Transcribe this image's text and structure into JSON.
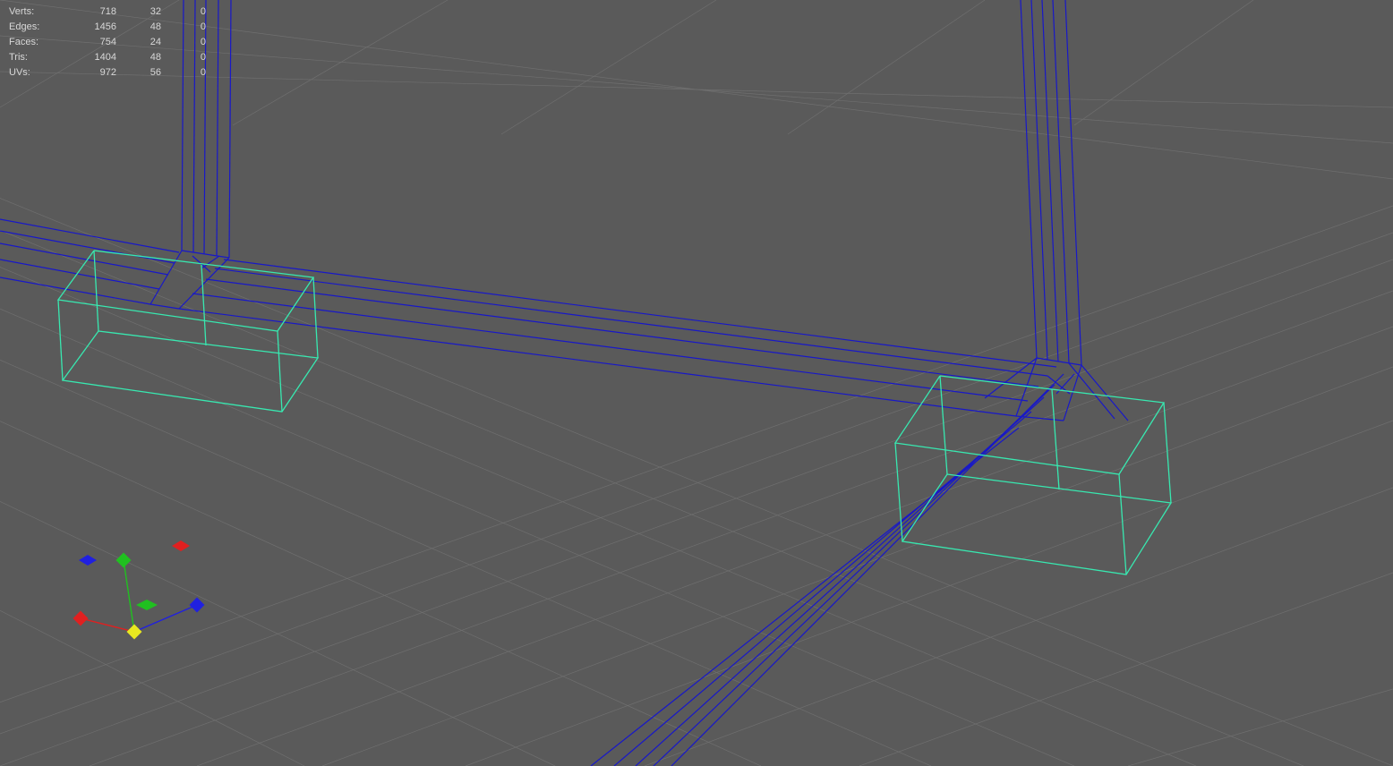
{
  "stats": {
    "rows": [
      {
        "label": "Verts:",
        "v1": "718",
        "v2": "32",
        "v3": "0"
      },
      {
        "label": "Edges:",
        "v1": "1456",
        "v2": "48",
        "v3": "0"
      },
      {
        "label": "Faces:",
        "v1": "754",
        "v2": "24",
        "v3": "0"
      },
      {
        "label": "Tris:",
        "v1": "1404",
        "v2": "48",
        "v3": "0"
      },
      {
        "label": "UVs:",
        "v1": "972",
        "v2": "56",
        "v3": "0"
      }
    ]
  },
  "colors": {
    "grid": "#6f6f6f",
    "wireframe": "#2020c0",
    "selected": "#40e8b8",
    "axis_x": "#e02020",
    "axis_y": "#20c020",
    "axis_z": "#2020e0",
    "axis_center": "#e8e820"
  }
}
